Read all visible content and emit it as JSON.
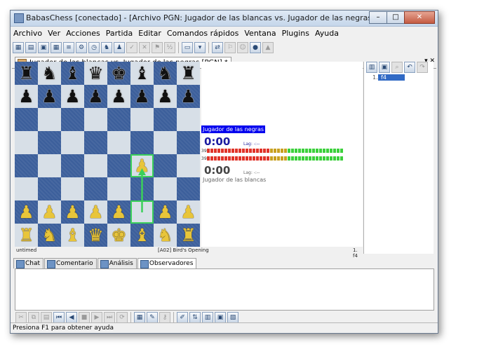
{
  "window": {
    "title": "BabasChess [conectado] - [Archivo PGN: Jugador de las blancas vs. Jugador de las negras *]"
  },
  "menu": [
    "Archivo",
    "Ver",
    "Acciones",
    "Partida",
    "Editar",
    "Comandos rápidos",
    "Ventana",
    "Plugins",
    "Ayuda"
  ],
  "toolbar": {
    "icons": [
      "new-game-icon",
      "open-icon",
      "save-icon",
      "board-icon",
      "list-icon",
      "engine-icon",
      "clock-icon",
      "seek-icon",
      "pieces-icon",
      "check-icon",
      "close-icon",
      "resign-icon",
      "draw-icon",
      "view-icon",
      "settings-icon",
      "connect-icon",
      "flag-icon",
      "globe-icon",
      "alert-icon"
    ]
  },
  "document_tab": {
    "label": "Jugador de las blancas vs. Jugador de las negras [PGN] *"
  },
  "board": {
    "rows": [
      [
        "♜",
        "♞",
        "♝",
        "♛",
        "♚",
        "♝",
        "♞",
        "♜"
      ],
      [
        "♟",
        "♟",
        "♟",
        "♟",
        "♟",
        "♟",
        "♟",
        "♟"
      ],
      [
        "",
        "",
        "",
        "",
        "",
        "",
        "",
        ""
      ],
      [
        "",
        "",
        "",
        "",
        "",
        "",
        "",
        ""
      ],
      [
        "",
        "",
        "",
        "",
        "",
        "♙",
        "",
        ""
      ],
      [
        "",
        "",
        "",
        "",
        "",
        "",
        "",
        ""
      ],
      [
        "♙",
        "♙",
        "♙",
        "♙",
        "♙",
        "",
        "♙",
        "♙"
      ],
      [
        "♖",
        "♘",
        "♗",
        "♕",
        "♔",
        "♗",
        "♘",
        "♖"
      ]
    ],
    "status_left": "untimed",
    "status_opening": "[A02] Bird's Opening",
    "status_move": "1. f4"
  },
  "clocks": {
    "black_player": "Jugador de las negras",
    "black_time": "0:00",
    "black_lag": "Lag: -:--",
    "black_bar_value": "39",
    "white_bar_value": "39",
    "white_time": "0:00",
    "white_lag": "Lag: -:--",
    "white_player": "Jugador de las blancas"
  },
  "move_tree": {
    "prefix": "1.",
    "move": "f4"
  },
  "panel_tabs": [
    "Chat",
    "Comentario",
    "Análisis",
    "Observadores"
  ],
  "statusbar": {
    "text": "Presiona F1 para obtener ayuda"
  },
  "colors": {
    "dark_square": "#3c5f9b",
    "light_square": "#d7dfe7",
    "highlight": "#3bd05a",
    "clock_label_bg": "#0000ee"
  }
}
